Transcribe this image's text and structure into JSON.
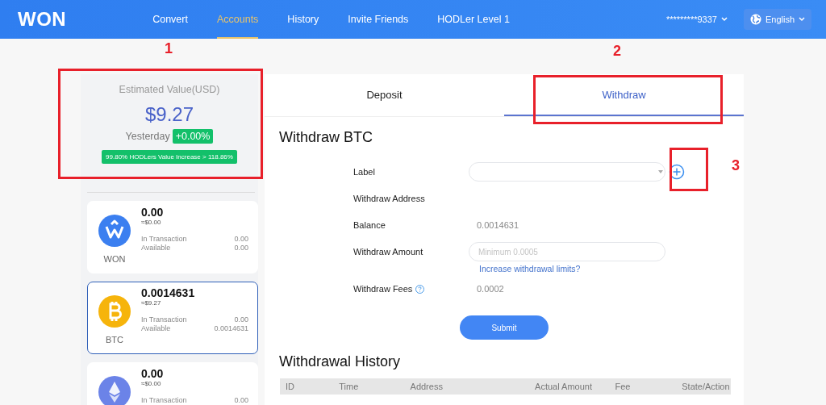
{
  "header": {
    "logo": "WON",
    "nav": [
      {
        "label": "Convert",
        "selected": false
      },
      {
        "label": "Accounts",
        "selected": true
      },
      {
        "label": "History",
        "selected": false
      },
      {
        "label": "Invite Friends",
        "selected": false
      },
      {
        "label": "HODLer Level 1",
        "selected": false
      }
    ],
    "account": "*********9337",
    "language": "English"
  },
  "summary": {
    "title": "Estimated Value(USD)",
    "value": "$9.27",
    "yesterday_label": "Yesterday",
    "change": "+0.00%",
    "hodl_badge": "99.80% HODLers Value Increase > 118.86%"
  },
  "assets": [
    {
      "kind": "won",
      "symbol": "WON",
      "amount": "0.00",
      "usd": "≈$0.00",
      "in_transaction_label": "In Transaction",
      "in_transaction": "0.00",
      "available_label": "Available",
      "available": "0.00",
      "selected": false
    },
    {
      "kind": "btc",
      "symbol": "BTC",
      "amount": "0.0014631",
      "usd": "≈$9.27",
      "in_transaction_label": "In Transaction",
      "in_transaction": "0.00",
      "available_label": "Available",
      "available": "0.0014631",
      "selected": true
    },
    {
      "kind": "eth",
      "amount": "0.00",
      "usd": "≈$0.00",
      "in_transaction_label": "In Transaction",
      "in_transaction": "0.00",
      "selected": false
    }
  ],
  "tabs": [
    {
      "label": "Deposit",
      "selected": false
    },
    {
      "label": "Withdraw",
      "selected": true
    }
  ],
  "form": {
    "title": "Withdraw BTC",
    "rows": [
      {
        "kind": "select",
        "label": "Label"
      },
      {
        "kind": "empty",
        "label": "Withdraw Address"
      },
      {
        "kind": "value",
        "label": "Balance",
        "value": "0.0014631"
      },
      {
        "kind": "input",
        "label": "Withdraw Amount",
        "placeholder": "Minimum 0.0005",
        "link": "Increase withdrawal limits?"
      },
      {
        "kind": "value",
        "label": "Withdraw Fees",
        "value": "0.0002",
        "help": true
      }
    ],
    "submit": "Submit"
  },
  "history": {
    "title": "Withdrawal History",
    "columns": [
      "ID",
      "Time",
      "Address",
      "Actual Amount",
      "Fee",
      "State/Action"
    ]
  },
  "annotations": [
    {
      "label": "1"
    },
    {
      "label": "2"
    },
    {
      "label": "3"
    }
  ]
}
